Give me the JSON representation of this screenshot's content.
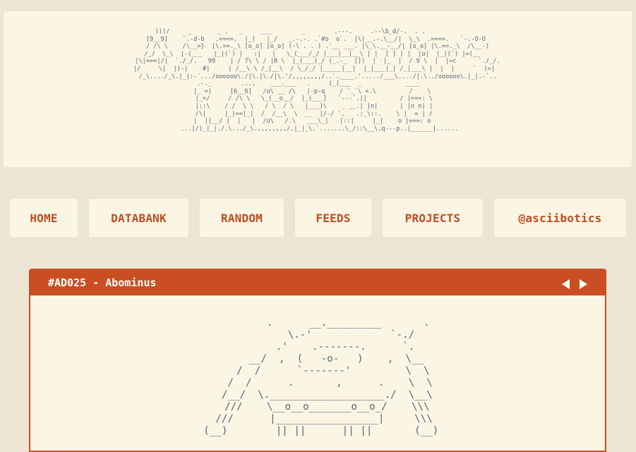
{
  "logo": {
    "ascii": "  )))/     _       _ .   _     ___        _        .---.     .--\\b_d/-.  . .                 \n[9__9]    `.-d-b   .====.  |_|   |_/   _.-.-. .`#o  o`.  |\\|__.-.\\__/|  \\_\\  .====.   `-.-O-O \n / /\\ \\    /\\__=}  |\\.==._\\ [o_o] [o_o] (-\\ . . ) .`__ ___. |\\_\\.__-__/| [o_o] |\\.==._\\  /\\__-) \n/_/  \\_\\  |-(___   |_|(`) |   :|   |   \\_(___/_/ |___|__|__\\ | |  [ ] | |  |o|  |_|(`) |=(__   \n|\\|===|/|  `./_/.   99    | / 7\\ \\ / |8 \\  |_(___)_/ (_.-_  [])  |  |_  |  / 9 \\  |  |=c      `./_/.\n|/     \\|  |)-|    #|     | /__\\ \\ /_|__\\  / \\_/_/ |_____|__|  |_|___|_| /_|___\\ |  |  |     `  )=|  \n/_\\..../_\\.|_|:-`.../oooooo\\./|\\.|\\./|\\.'/,,,,,,,,/..`.____.'...../___\\..../|.\\../oooooo\\.|_|.-`..",
    "ascii2": "    .-._        ...,    ___.___   .     (_(___  _            ____         \n     |_ =|     [6__6]   /o\\ __ /\\   |-p-q    / `_`\\ +.\\         /    \\        \n     |_=/     / /\\ \\   \\_(__o__/  |_(___]   `---`.||         / |===: \\       \n     |::\\    / /  \\ \\   / \\  / \\   |___)\\    _ __.| |n|      | |n n| |       \n     /\\|     |_|==|_|  /  /__\\  \\  __  |/-/ `.   .:_\\::.    \\ |  = | /       \n    |  ||__/ |  |   |  /o\\   /.\\   ___\\_|   |::|     |_|    o |===: o       \n ...|/)_|_|./.\\.../_\\.,,,,,,,,/.|_|_\\.`.......\\_/::\\__\\.q---p..|______|......"
  },
  "nav": {
    "items": [
      {
        "label": "HOME"
      },
      {
        "label": "DATABANK"
      },
      {
        "label": "RANDOM"
      },
      {
        "label": "FEEDS"
      },
      {
        "label": "PROJECTS"
      },
      {
        "label": "@asciibotics"
      }
    ]
  },
  "panel": {
    "title": "#AD025 - Abominus",
    "ascii": "          .      __._________       .\n           \\.-'             `-./\n         .'    .-------.      `.\n      __/  ,  (   -o-   )    ,  \\__\n     /  /      `-------'         \\  \\\n    /  /      .       ,      .    \\  \\\n   /__/  \\.___________________./  \\__\\\n   ///    \\__o__o_______o__o_/    \\\\\\\n  ///      |_________________|     \\\\\\\n (__)        || ||      || ||       (__)"
  }
}
